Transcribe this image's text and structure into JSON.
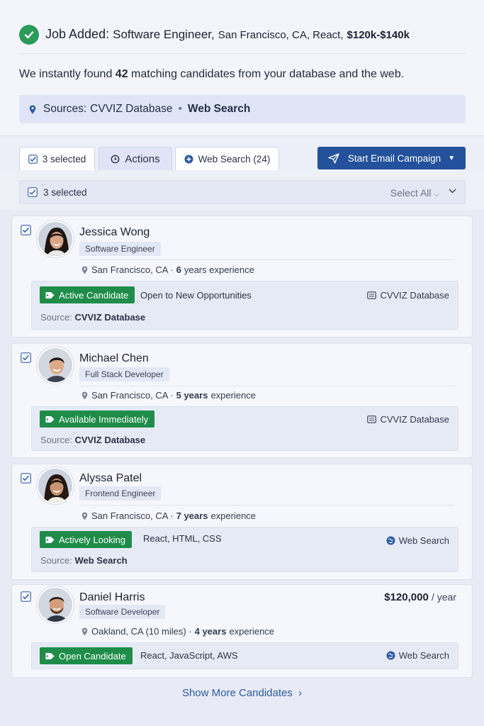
{
  "header": {
    "title_prefix": "Job Added:",
    "job_title": "Software Engineer,",
    "job_details": "San Francisco, CA, React,",
    "salary_range": "$120k-$140k",
    "found_pre": "We instantly found",
    "found_count": "42",
    "found_post": "matching candidates from your database and the web.",
    "sources_label": "Sources:",
    "source_db": "CVVIZ Database",
    "source_sep": "•",
    "source_web": "Web Search"
  },
  "tabs": {
    "selected": "3 selected",
    "actions": "Actions",
    "web_search": "Web Search (24)"
  },
  "campaign_button": "Start Email Campaign",
  "selection_bar": {
    "label": "3 selected",
    "select_all": "Select All"
  },
  "candidates": [
    {
      "name": "Jessica Wong",
      "role": "Software Engineer",
      "location": "San Francisco, CA ·",
      "years": "6",
      "years_suffix": "years experience",
      "tag": "Active Candidate",
      "note": "Open to New Opportunities",
      "source_badge": "CVVIZ Database",
      "source_label": "Source:",
      "source_value": "CVVIZ Database"
    },
    {
      "name": "Michael Chen",
      "role": "Full Stack Developer",
      "location": "San Francisco, CA ·",
      "years": "5 years",
      "years_suffix": "experience",
      "tag": "Available Immediately",
      "source_badge": "CVVIZ Database",
      "source_label": "Source:",
      "source_value": "CVVIZ Database"
    },
    {
      "name": "Alyssa Patel",
      "role": "Frontend Engineer",
      "location": "San Francisco, CA ·",
      "years": "7 years",
      "years_suffix": "experience",
      "tag": "Actively Looking",
      "note": "React, HTML, CSS",
      "source_badge": "Web Search",
      "source_label": "Source:",
      "source_value": "Web Search"
    },
    {
      "name": "Daniel Harris",
      "role": "Software Developer",
      "location": "Oakland, CA (10 miles) ·",
      "years": "4 years",
      "years_suffix": "experience",
      "tag": "Open Candidate",
      "note": "React, JavaScript, AWS",
      "source_badge": "Web Search",
      "salary": "$120,000",
      "salary_unit": "/ year"
    }
  ],
  "show_more": "Show More Candidates",
  "colors": {
    "accent_blue": "#23519b",
    "success_green": "#1f8d49",
    "link_blue": "#2b5aa0"
  }
}
